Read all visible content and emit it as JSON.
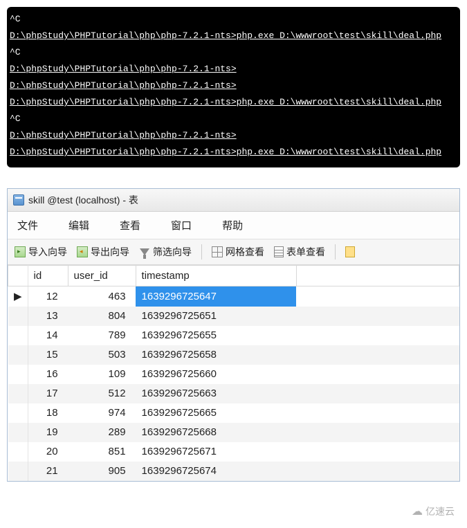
{
  "terminal": {
    "lines": [
      {
        "text": "^C",
        "u": false
      },
      {
        "text": "D:\\phpStudy\\PHPTutorial\\php\\php-7.2.1-nts>php.exe D:\\wwwroot\\test\\skill\\deal.php",
        "u": true
      },
      {
        "text": "^C",
        "u": false
      },
      {
        "text": "D:\\phpStudy\\PHPTutorial\\php\\php-7.2.1-nts>",
        "u": true
      },
      {
        "text": "D:\\phpStudy\\PHPTutorial\\php\\php-7.2.1-nts>",
        "u": true
      },
      {
        "text": "D:\\phpStudy\\PHPTutorial\\php\\php-7.2.1-nts>php.exe D:\\wwwroot\\test\\skill\\deal.php",
        "u": true
      },
      {
        "text": "^C",
        "u": false
      },
      {
        "text": "D:\\phpStudy\\PHPTutorial\\php\\php-7.2.1-nts>",
        "u": true
      },
      {
        "text": "D:\\phpStudy\\PHPTutorial\\php\\php-7.2.1-nts>php.exe D:\\wwwroot\\test\\skill\\deal.php",
        "u": true
      }
    ]
  },
  "db": {
    "title": "skill @test (localhost) - 表",
    "menu": {
      "file": "文件",
      "edit": "编辑",
      "view": "查看",
      "window": "窗口",
      "help": "帮助"
    },
    "toolbar": {
      "import": "导入向导",
      "export": "导出向导",
      "filter": "筛选向导",
      "gridview": "网格查看",
      "formview": "表单查看"
    },
    "columns": {
      "id": "id",
      "user_id": "user_id",
      "timestamp": "timestamp"
    },
    "rows": [
      {
        "id": "12",
        "user_id": "463",
        "timestamp": "1639296725647",
        "current": true
      },
      {
        "id": "13",
        "user_id": "804",
        "timestamp": "1639296725651",
        "current": false
      },
      {
        "id": "14",
        "user_id": "789",
        "timestamp": "1639296725655",
        "current": false
      },
      {
        "id": "15",
        "user_id": "503",
        "timestamp": "1639296725658",
        "current": false
      },
      {
        "id": "16",
        "user_id": "109",
        "timestamp": "1639296725660",
        "current": false
      },
      {
        "id": "17",
        "user_id": "512",
        "timestamp": "1639296725663",
        "current": false
      },
      {
        "id": "18",
        "user_id": "974",
        "timestamp": "1639296725665",
        "current": false
      },
      {
        "id": "19",
        "user_id": "289",
        "timestamp": "1639296725668",
        "current": false
      },
      {
        "id": "20",
        "user_id": "851",
        "timestamp": "1639296725671",
        "current": false
      },
      {
        "id": "21",
        "user_id": "905",
        "timestamp": "1639296725674",
        "current": false
      }
    ]
  },
  "watermark": {
    "text": "亿速云"
  }
}
